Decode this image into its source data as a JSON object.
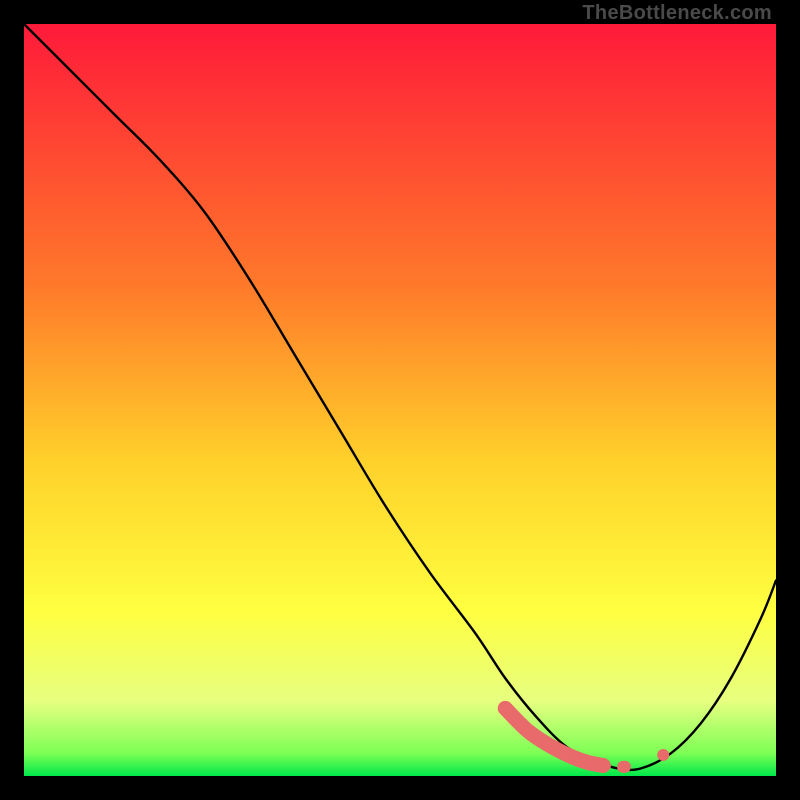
{
  "watermark": "TheBottleneck.com",
  "chart_data": {
    "type": "line",
    "title": "",
    "xlabel": "",
    "ylabel": "",
    "xlim": [
      0,
      100
    ],
    "ylim": [
      0,
      100
    ],
    "grid": false,
    "legend": false,
    "gradient_stops": [
      {
        "offset": 0,
        "color": "#ff1a3a"
      },
      {
        "offset": 35,
        "color": "#ff7a2a"
      },
      {
        "offset": 58,
        "color": "#ffd02a"
      },
      {
        "offset": 78,
        "color": "#ffff40"
      },
      {
        "offset": 90,
        "color": "#e7ff80"
      },
      {
        "offset": 97,
        "color": "#7dff55"
      },
      {
        "offset": 100,
        "color": "#00e84b"
      }
    ],
    "series": [
      {
        "name": "bottleneck-curve",
        "color": "#000000",
        "x": [
          0,
          6,
          12,
          18,
          24,
          30,
          36,
          42,
          48,
          54,
          60,
          64,
          68,
          72,
          76,
          79,
          82,
          86,
          90,
          94,
          98,
          100
        ],
        "y": [
          100,
          94,
          88,
          82,
          75,
          66,
          56,
          46,
          36,
          27,
          19,
          13,
          8,
          4,
          2,
          1,
          1,
          3,
          7,
          13,
          21,
          26
        ]
      }
    ],
    "highlight_segment": {
      "name": "optimal-range",
      "color": "#e86a6a",
      "x": [
        64,
        67,
        70,
        73,
        75,
        77,
        79,
        80.5,
        82
      ],
      "y": [
        9,
        6,
        4,
        2.5,
        1.8,
        1.4,
        1.2,
        1.3,
        1.6
      ],
      "style": "thick-rounded-dotted-tail"
    },
    "highlight_point": {
      "x": 85,
      "y": 2.8,
      "color": "#e86a6a",
      "r": 6
    }
  }
}
